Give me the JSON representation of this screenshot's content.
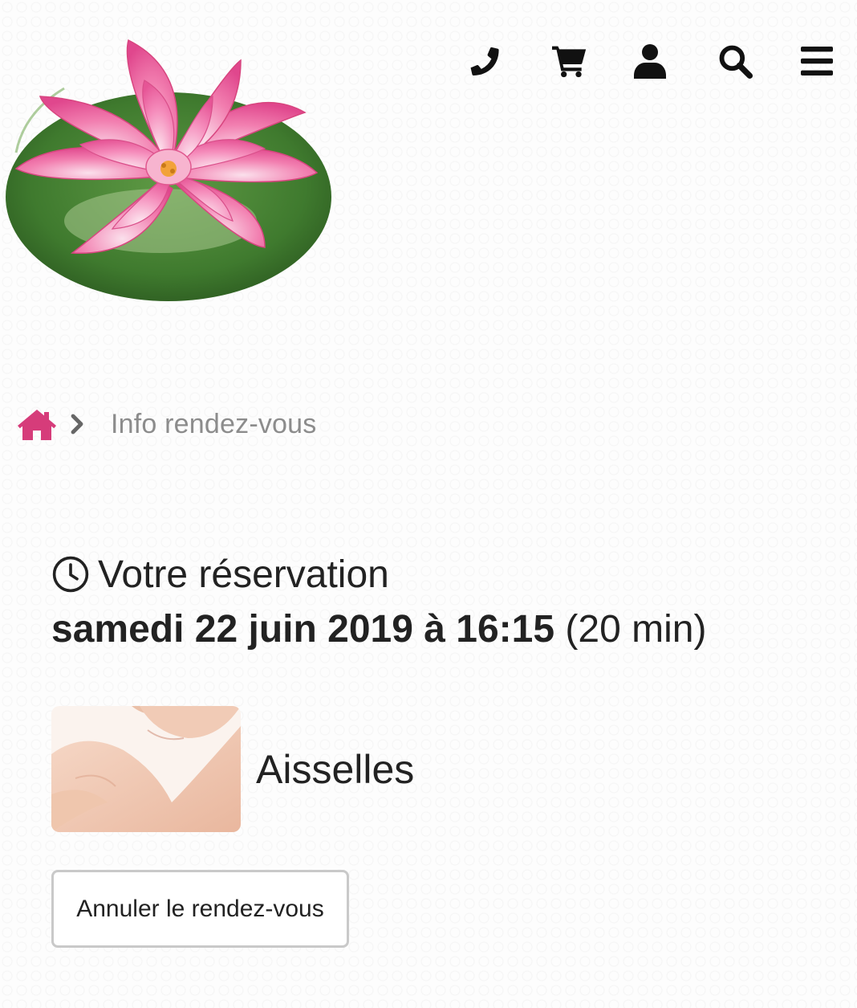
{
  "header": {
    "nav": [
      {
        "icon": "phone-icon"
      },
      {
        "icon": "cart-icon"
      },
      {
        "icon": "user-icon"
      },
      {
        "icon": "search-icon"
      },
      {
        "icon": "menu-icon"
      }
    ]
  },
  "breadcrumb": {
    "home_icon": "home-icon",
    "current": "Info rendez-vous"
  },
  "reservation": {
    "heading": "Votre réservation",
    "date": "samedi 22 juin 2019 à 16:15",
    "duration": "(20 min)"
  },
  "service": {
    "name": "Aisselles"
  },
  "actions": {
    "cancel_label": "Annuler le rendez-vous"
  },
  "colors": {
    "accent": "#d63c7a",
    "text": "#222222",
    "muted": "#8c8c8c"
  }
}
